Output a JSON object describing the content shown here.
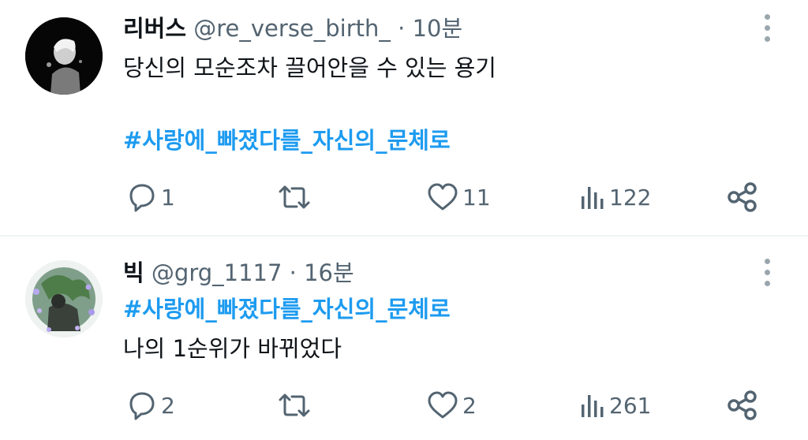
{
  "tweets": [
    {
      "author_name": "리버스",
      "handle": "@re_verse_birth_",
      "separator": "·",
      "time": "10분",
      "body_text": "당신의 모순조차 끌어안을 수 있는 용기",
      "hashtag": "#사랑에_빠졌다를_자신의_문체로",
      "replies": "1",
      "retweets": "",
      "likes": "11",
      "views": "122"
    },
    {
      "author_name": "빅",
      "handle": "@grg_1117",
      "separator": "·",
      "time": "16분",
      "hashtag": "#사랑에_빠졌다를_자신의_문체로",
      "body_text": "나의 1순위가 바뀌었다",
      "replies": "2",
      "retweets": "",
      "likes": "2",
      "views": "261"
    }
  ],
  "icons": {
    "reply": "reply-icon",
    "retweet": "retweet-icon",
    "like": "heart-icon",
    "views": "views-icon",
    "share": "share-icon",
    "more": "more-vertical-icon"
  },
  "colors": {
    "hashtag": "#1d9bf0",
    "secondary_text": "#536471",
    "icon": "#536471",
    "divider": "#eff3f4"
  }
}
